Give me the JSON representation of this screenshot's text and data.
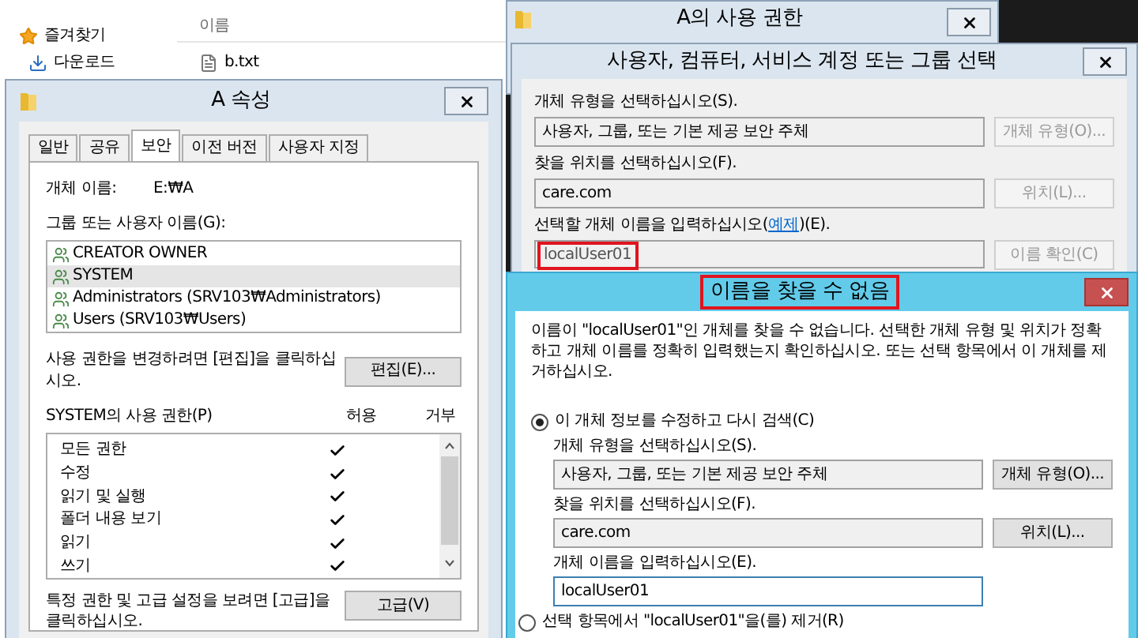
{
  "explorer": {
    "nav_items": [
      {
        "label": "즐겨찾기",
        "kind": "star"
      },
      {
        "label": "다운로드",
        "kind": "download"
      }
    ],
    "column_header": "이름",
    "files": [
      "b.txt"
    ]
  },
  "properties": {
    "title": "A 속성",
    "tabs": [
      {
        "label": "일반",
        "selected": false
      },
      {
        "label": "공유",
        "selected": false
      },
      {
        "label": "보안",
        "selected": true
      },
      {
        "label": "이전 버전",
        "selected": false
      },
      {
        "label": "사용자 지정",
        "selected": false
      }
    ],
    "object_name_label": "개체 이름:",
    "object_name": "E:₩A",
    "groups_label": "그룹 또는 사용자 이름(G):",
    "groups": [
      {
        "name": "CREATOR OWNER",
        "selected": false
      },
      {
        "name": "SYSTEM",
        "selected": true
      },
      {
        "name": "Administrators (SRV103₩Administrators)",
        "selected": false
      },
      {
        "name": "Users (SRV103₩Users)",
        "selected": false
      }
    ],
    "edit_hint": "사용 권한을 변경하려면 [편집]을 클릭하십시오.",
    "edit_button": "편집(E)...",
    "permissions_label": "SYSTEM의 사용 권한(P)",
    "allow_header": "허용",
    "deny_header": "거부",
    "permissions": [
      {
        "name": "모든 권한",
        "allow": true,
        "deny": false
      },
      {
        "name": "수정",
        "allow": true,
        "deny": false
      },
      {
        "name": "읽기 및 실행",
        "allow": true,
        "deny": false
      },
      {
        "name": "폴더 내용 보기",
        "allow": true,
        "deny": false
      },
      {
        "name": "읽기",
        "allow": true,
        "deny": false
      },
      {
        "name": "쓰기",
        "allow": true,
        "deny": false
      }
    ],
    "advanced_hint": "특정 권한 및 고급 설정을 보려면 [고급]을 클릭하십시오.",
    "advanced_button": "고급(V)"
  },
  "permissions_window": {
    "title": "A의 사용 권한"
  },
  "select_dialog": {
    "title": "사용자, 컴퓨터, 서비스 계정 또는 그룹 선택",
    "object_type_label": "개체 유형을 선택하십시오(S).",
    "object_type": "사용자, 그룹, 또는 기본 제공 보안 주체",
    "object_type_button": {
      "label": "개체 유형(O)...",
      "disabled": true
    },
    "location_label": "찾을 위치를 선택하십시오(F).",
    "location": "care.com",
    "location_button": {
      "label": "위치(L)...",
      "disabled": true
    },
    "names_label_before": "선택할 개체 이름을 입력하십시오(",
    "names_link": "예제",
    "names_label_after": ")(E).",
    "names_value": "localUser01",
    "names_highlighted": true,
    "check_button": {
      "label": "이름 확인(C)",
      "disabled": true
    }
  },
  "error_dialog": {
    "title": "이름을 찾을 수 없음",
    "title_highlighted": true,
    "message": "이름이 \"localUser01\"인 개체를 찾을 수 없습니다. 선택한 개체 유형 및 위치가 정확하고 개체 이름를 정확히 입력했는지 확인하십시오. 또는 선택 항목에서 이 개체를 제거하십시오.",
    "options": [
      {
        "label": "이 개체 정보를 수정하고 다시 검색(C)",
        "selected": true
      },
      {
        "label": "선택 항목에서 \"localUser01\"을(를) 제거(R)",
        "selected": false
      }
    ],
    "object_type_label": "개체 유형을 선택하십시오(S).",
    "object_type": "사용자, 그룹, 또는 기본 제공 보안 주체",
    "object_type_button": {
      "label": "개체 유형(O)...",
      "disabled": false
    },
    "location_label": "찾을 위치를 선택하십시오(F).",
    "location": "care.com",
    "location_button": {
      "label": "위치(L)...",
      "disabled": false
    },
    "name_label": "개체 이름을 입력하십시오(E).",
    "name_value": "localUser01"
  }
}
